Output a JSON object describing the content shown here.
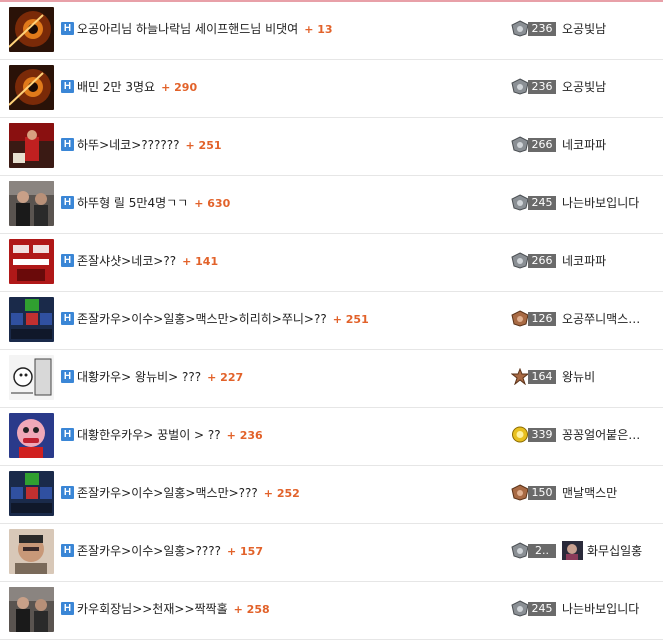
{
  "posts": [
    {
      "title": "오공아리님 하늘나락님 세이프핸드님 비댓여",
      "count": "+ 13",
      "level": "236",
      "nick": "오공빛남",
      "emblem": "silver",
      "thumb": "galaxy"
    },
    {
      "title": "배민 2만 3명요",
      "count": "+ 290",
      "level": "236",
      "nick": "오공빛남",
      "emblem": "silver",
      "thumb": "galaxy"
    },
    {
      "title": "하뚜>네코>??????",
      "count": "+ 251",
      "level": "266",
      "nick": "네코파파",
      "emblem": "silver",
      "thumb": "red-room"
    },
    {
      "title": "하뚜형 릴 5만4명ㄱㄱ",
      "count": "+ 630",
      "level": "245",
      "nick": "나는바보입니다",
      "emblem": "silver",
      "thumb": "people"
    },
    {
      "title": "존잘샤샷>네코>??",
      "count": "+ 141",
      "level": "266",
      "nick": "네코파파",
      "emblem": "silver",
      "thumb": "red-screen"
    },
    {
      "title": "존잘카우>이수>일홍>맥스만>히리히>쭈니>??",
      "count": "+ 251",
      "level": "126",
      "nick": "오공쭈니맥스…",
      "emblem": "bronze",
      "thumb": "dashboard"
    },
    {
      "title": "대황카우> 왕뉴비> ???",
      "count": "+ 227",
      "level": "164",
      "nick": "왕뉴비",
      "emblem": "bronze-star",
      "thumb": "manga"
    },
    {
      "title": "대황한우카우> 꿍벌이 > ??",
      "count": "+ 236",
      "level": "339",
      "nick": "꽁꽁얼어붙은…",
      "emblem": "gold",
      "thumb": "cartoon"
    },
    {
      "title": "존잘카우>이수>일홍>맥스만>???",
      "count": "+ 252",
      "level": "150",
      "nick": "맨날맥스만",
      "emblem": "bronze",
      "thumb": "dashboard"
    },
    {
      "title": "존잘카우>이수>일홍>????",
      "count": "+ 157",
      "level": "2..",
      "nick": "화무십일홍",
      "emblem": "silver",
      "thumb": "face",
      "avatar": true
    },
    {
      "title": "카우회장님>>천재>>짝짝홀",
      "count": "+ 258",
      "level": "245",
      "nick": "나는바보입니다",
      "emblem": "silver",
      "thumb": "people"
    }
  ],
  "badge_letter": "H",
  "colors": {
    "accent": "#e2622a",
    "badge": "#3a86d6",
    "level_bg": "#6a6a6a"
  }
}
